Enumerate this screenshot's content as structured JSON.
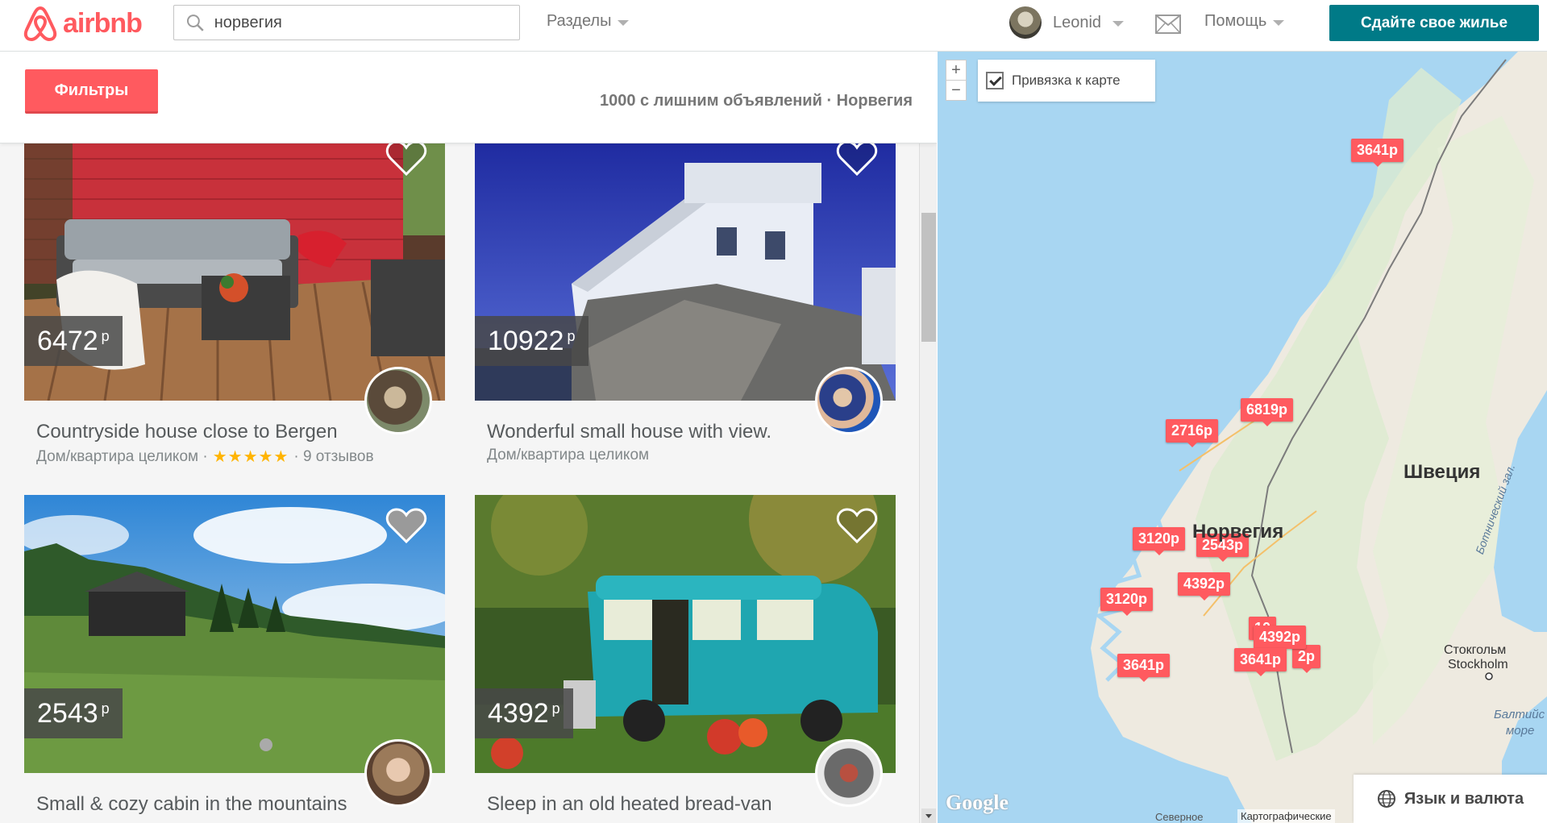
{
  "header": {
    "logo_text": "airbnb",
    "search_value": "норвегия",
    "sections_label": "Разделы",
    "user_name": "Leonid",
    "help_label": "Помощь",
    "host_button": "Сдайте свое жилье"
  },
  "filters": {
    "button_label": "Фильтры",
    "results_summary": "1000 с лишним объявлений · Норвегия"
  },
  "listings": [
    {
      "price": "6472",
      "currency": "р",
      "title": "Countryside house close to Bergen",
      "type": "Дом/квартира целиком ·",
      "stars": "★★★★★",
      "reviews": "· 9 отзывов",
      "heart_filled": false
    },
    {
      "price": "10922",
      "currency": "р",
      "title": "Wonderful small house with view.",
      "type": "Дом/квартира целиком",
      "stars": "",
      "reviews": "",
      "heart_filled": false
    },
    {
      "price": "2543",
      "currency": "р",
      "title": "Small & cozy cabin in the mountains",
      "type": "",
      "stars": "",
      "reviews": "",
      "heart_filled": true
    },
    {
      "price": "4392",
      "currency": "р",
      "title": "Sleep in an old heated bread-van",
      "type": "",
      "stars": "",
      "reviews": "",
      "heart_filled": false
    }
  ],
  "map": {
    "zoom_in": "+",
    "zoom_out": "−",
    "sync_label": "Привязка к карте",
    "sync_checked": true,
    "pins": [
      "3641р",
      "6819р",
      "2716р",
      "3120р",
      "2543р",
      "4392р",
      "3120р",
      "4392р",
      "3641р",
      "3641р",
      "10",
      "2р"
    ],
    "labels": {
      "sweden": "Швеция",
      "norway": "Норвегия",
      "stockholm_ru": "Стокгольм",
      "stockholm": "Stockholm",
      "baltic": "Балтийс",
      "baltic2": "море",
      "gulf": "Ботнический зал.",
      "north": "Северное"
    },
    "google": "Google",
    "attribution": "Картографические",
    "lang_button": "Язык и валюта"
  }
}
